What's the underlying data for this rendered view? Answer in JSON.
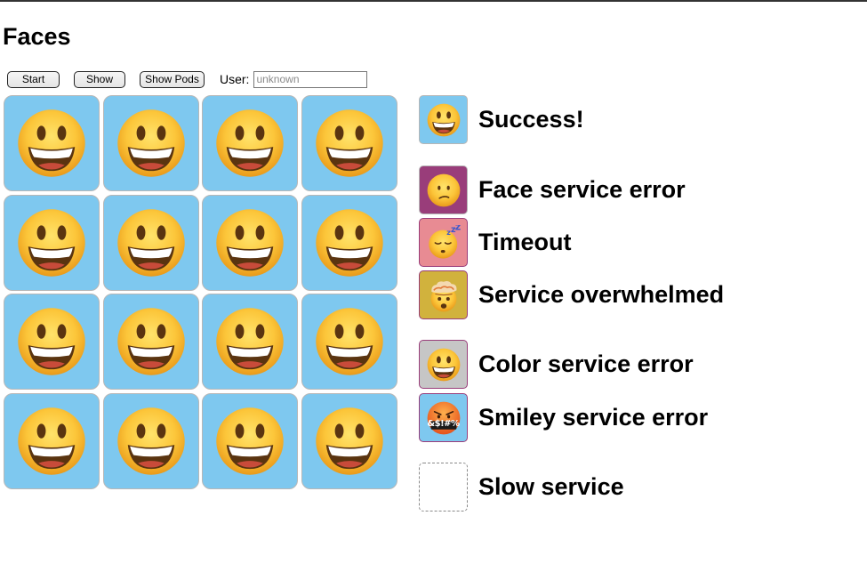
{
  "header": {
    "title": "Faces"
  },
  "controls": {
    "start_label": "Start",
    "show_label": "Show",
    "show_pods_label": "Show Pods",
    "user_label": "User:",
    "user_placeholder": "unknown"
  },
  "grid": {
    "rows": 4,
    "columns": 4,
    "cell_color": "#7ec8ef",
    "cell_icon": "grinning-face-icon"
  },
  "legend": [
    {
      "label": "Success!",
      "color": "#7ec8ef",
      "border": "#b7b7b7",
      "icon": "grinning-face-icon"
    },
    {
      "label": "Face service error",
      "color": "#993d7a",
      "border": "#b7b7b7",
      "icon": "confused-face-icon"
    },
    {
      "label": "Timeout",
      "color": "#e88b93",
      "border": "#993d7a",
      "icon": "sleeping-face-icon"
    },
    {
      "label": "Service overwhelmed",
      "color": "#d1b23d",
      "border": "#993d7a",
      "icon": "exploding-head-icon"
    },
    {
      "label": "Color service error",
      "color": "#c6c6c6",
      "border": "#993d7a",
      "icon": "grinning-face-icon"
    },
    {
      "label": "Smiley service error",
      "color": "#7ec8ef",
      "border": "#993d7a",
      "icon": "cursing-face-icon",
      "icon_text": "&$!#%"
    },
    {
      "label": "Slow service",
      "color": "#ffffff",
      "border": "#8a8a8a",
      "icon": "empty-dashed-box-icon"
    }
  ]
}
